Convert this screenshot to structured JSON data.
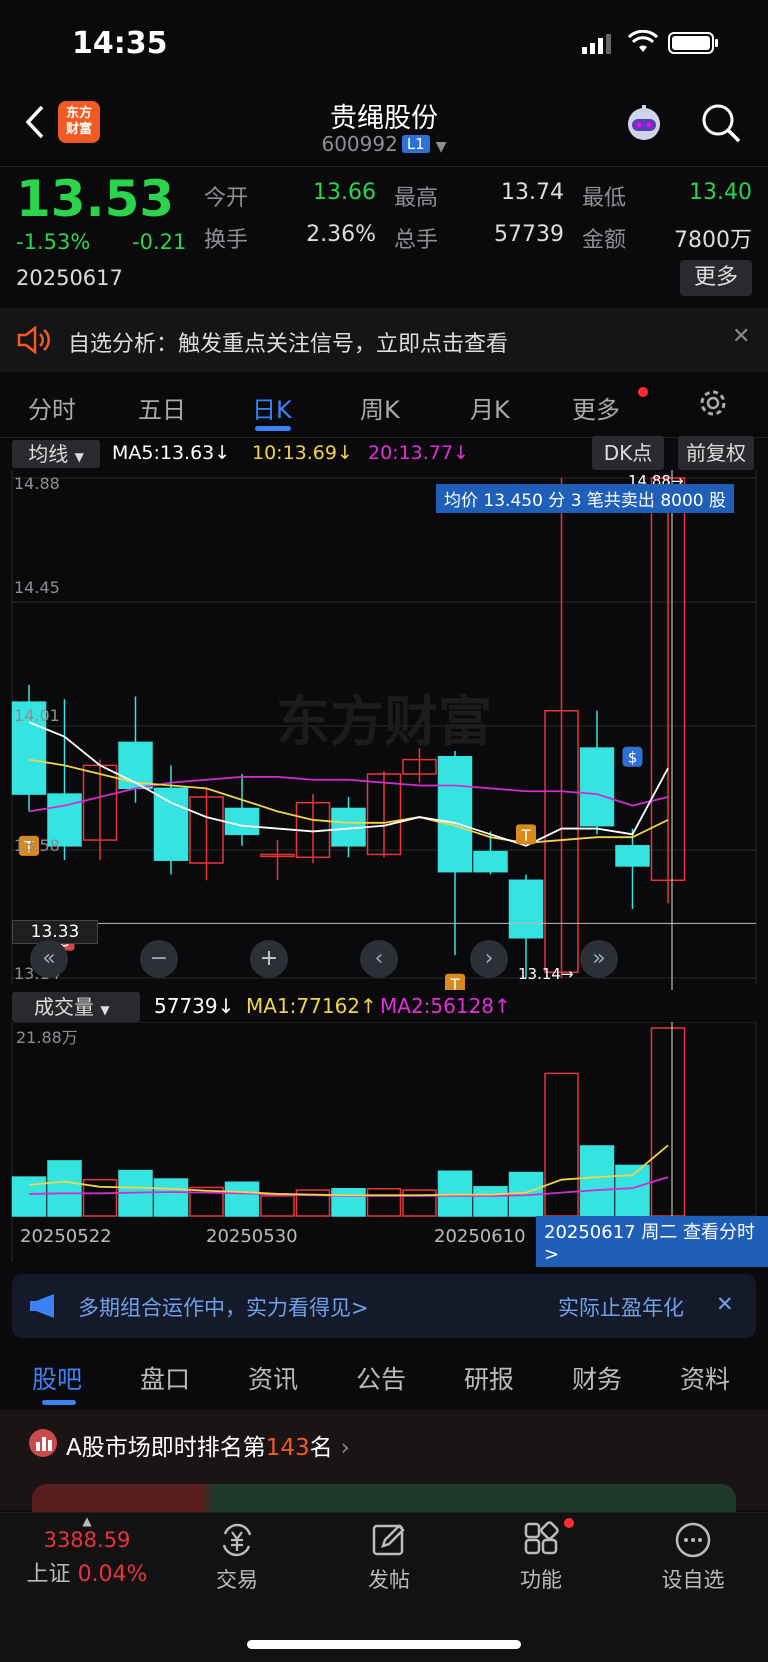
{
  "status": {
    "time": "14:35"
  },
  "header": {
    "title": "贵绳股份",
    "code": "600992",
    "badge": "L1",
    "logo": "东方\n财富"
  },
  "quote": {
    "price": "13.53",
    "change_pct": "-1.53%",
    "change": "-0.21",
    "date": "20250617",
    "open_label": "今开",
    "open": "13.66",
    "high_label": "最高",
    "high": "13.74",
    "low_label": "最低",
    "low": "13.40",
    "turnover_label": "换手",
    "turnover": "2.36%",
    "volume_label": "总手",
    "volume": "57739",
    "amount_label": "金额",
    "amount": "7800万",
    "more": "更多"
  },
  "notice": {
    "text": "自选分析：触发重点关注信号，立即点击查看"
  },
  "tabs": [
    "分时",
    "五日",
    "日K",
    "周K",
    "月K",
    "更多"
  ],
  "kline": {
    "ma_selector": "均线",
    "ma5": "MA5:13.63↓",
    "ma10": "10:13.69↓",
    "ma20": "20:13.77↓",
    "dk": "DK点",
    "fq": "前复权",
    "axis": [
      "14.88",
      "14.45",
      "14.01",
      "13.58",
      "13.14"
    ],
    "crosshair_price": "13.33",
    "high_mark": "14.88→",
    "low_mark": "13.14→",
    "tooltip": "均价 13.450 分 3 笔共卖出 8000 股",
    "watermark": "东方财富"
  },
  "volume": {
    "selector": "成交量",
    "value": "57739↓",
    "ma1": "MA1:77162↑",
    "ma2": "MA2:56128↑",
    "axis_top": "21.88万",
    "dates": [
      "20250522",
      "20250530",
      "20250610"
    ],
    "tooltip": "20250617 周二 查看分时>"
  },
  "chart_data": {
    "type": "candlestick",
    "candles": [
      {
        "o": 14.1,
        "c": 13.78,
        "h": 14.16,
        "l": 13.72,
        "dir": "down"
      },
      {
        "o": 13.6,
        "c": 13.78,
        "h": 14.11,
        "l": 13.55,
        "dir": "down"
      },
      {
        "o": 13.62,
        "c": 13.88,
        "h": 13.9,
        "l": 13.55,
        "dir": "up"
      },
      {
        "o": 13.96,
        "c": 13.8,
        "h": 14.12,
        "l": 13.75,
        "dir": "down"
      },
      {
        "o": 13.8,
        "c": 13.55,
        "h": 13.88,
        "l": 13.5,
        "dir": "down"
      },
      {
        "o": 13.54,
        "c": 13.77,
        "h": 13.8,
        "l": 13.48,
        "dir": "up"
      },
      {
        "o": 13.73,
        "c": 13.64,
        "h": 13.85,
        "l": 13.6,
        "dir": "down"
      },
      {
        "o": 13.57,
        "c": 13.57,
        "h": 13.62,
        "l": 13.48,
        "dir": "up"
      },
      {
        "o": 13.56,
        "c": 13.75,
        "h": 13.78,
        "l": 13.54,
        "dir": "up"
      },
      {
        "o": 13.73,
        "c": 13.6,
        "h": 13.77,
        "l": 13.56,
        "dir": "down"
      },
      {
        "o": 13.57,
        "c": 13.85,
        "h": 13.86,
        "l": 13.56,
        "dir": "up"
      },
      {
        "o": 13.85,
        "c": 13.9,
        "h": 13.94,
        "l": 13.82,
        "dir": "up"
      },
      {
        "o": 13.91,
        "c": 13.51,
        "h": 13.93,
        "l": 13.22,
        "dir": "down"
      },
      {
        "o": 13.58,
        "c": 13.51,
        "h": 13.65,
        "l": 13.5,
        "dir": "down"
      },
      {
        "o": 13.48,
        "c": 13.28,
        "h": 13.5,
        "l": 13.14,
        "dir": "down"
      },
      {
        "o": 13.16,
        "c": 14.07,
        "h": 14.88,
        "l": 13.14,
        "dir": "up"
      },
      {
        "o": 13.94,
        "c": 13.67,
        "h": 14.07,
        "l": 13.64,
        "dir": "down"
      },
      {
        "o": 13.6,
        "c": 13.53,
        "h": 13.66,
        "l": 13.38,
        "dir": "down"
      },
      {
        "o": 13.48,
        "c": 14.88,
        "h": 14.88,
        "l": 13.4,
        "dir": "up"
      }
    ],
    "ma5": [
      14.03,
      13.98,
      13.88,
      13.82,
      13.75,
      13.7,
      13.67,
      13.66,
      13.65,
      13.66,
      13.67,
      13.7,
      13.68,
      13.64,
      13.6,
      13.66,
      13.66,
      13.64,
      13.87
    ],
    "ma10": [
      13.9,
      13.88,
      13.85,
      13.82,
      13.81,
      13.8,
      13.76,
      13.72,
      13.69,
      13.68,
      13.68,
      13.7,
      13.67,
      13.63,
      13.61,
      13.62,
      13.63,
      13.63,
      13.69
    ],
    "ma20": [
      13.72,
      13.74,
      13.77,
      13.8,
      13.82,
      13.83,
      13.84,
      13.84,
      13.83,
      13.83,
      13.82,
      13.81,
      13.81,
      13.8,
      13.79,
      13.79,
      13.78,
      13.74,
      13.77
    ],
    "volumes": [
      6.0,
      8.5,
      5.6,
      7.0,
      5.7,
      4.4,
      5.2,
      3.1,
      4.0,
      4.2,
      4.2,
      4.0,
      6.9,
      4.5,
      6.7,
      22.0,
      10.8,
      7.8,
      29.0
    ],
    "vol_ma1": [
      4.8,
      5.3,
      4.5,
      4.4,
      4.2,
      3.9,
      3.7,
      3.4,
      3.3,
      3.2,
      3.2,
      3.2,
      3.3,
      3.3,
      3.6,
      5.6,
      6.0,
      6.3,
      10.9
    ],
    "vol_ma2": [
      3.4,
      3.5,
      3.5,
      3.6,
      3.7,
      3.6,
      3.5,
      3.3,
      3.2,
      3.1,
      3.1,
      3.1,
      3.1,
      3.1,
      3.2,
      3.6,
      4.0,
      4.3,
      6.0
    ],
    "ylim": [
      13.14,
      14.88
    ]
  },
  "promo": {
    "text": "多期组合运作中，实力看得见>",
    "right": "实际止盈年化"
  },
  "bottom_tabs": [
    "股吧",
    "盘口",
    "资讯",
    "公告",
    "研报",
    "财务",
    "资料"
  ],
  "rank": {
    "prefix": "A股市场即时排名第",
    "num": "143",
    "suffix": "名"
  },
  "nav": {
    "index_value": "3388.59",
    "index_name": "上证",
    "index_pct": "0.04%",
    "items": [
      "交易",
      "发帖",
      "功能",
      "设自选"
    ]
  }
}
